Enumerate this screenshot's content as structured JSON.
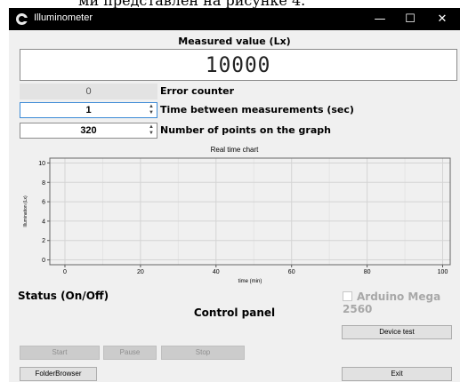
{
  "caption": "ми представлен на рисунке 4.",
  "window": {
    "title": "Illuminometer",
    "icon": "app-logo-icon",
    "controls": {
      "minimize": "—",
      "maximize": "☐",
      "close": "✕"
    }
  },
  "measured": {
    "label": "Measured value (Lx)",
    "value": "10000"
  },
  "error_counter": {
    "value": "0",
    "label": "Error counter"
  },
  "time_between": {
    "value": "1",
    "label": "Time between measurements (sec)"
  },
  "points": {
    "value": "320",
    "label": "Number of points on the graph"
  },
  "spin_arrow_up": "▲",
  "spin_arrow_down": "▼",
  "chart_data": {
    "type": "line",
    "title": "Real time chart",
    "xlabel": "time (min)",
    "ylabel": "Illumination (Lx)",
    "xlim": [
      -4,
      102
    ],
    "ylim": [
      -0.5,
      10.5
    ],
    "xticks": [
      0,
      20,
      40,
      60,
      80,
      100
    ],
    "yticks": [
      0,
      2,
      4,
      6,
      8,
      10
    ],
    "grid": true,
    "series": []
  },
  "status_label": "Status (On/Off)",
  "arduino": {
    "label": "Arduino Mega 2560",
    "checked": false
  },
  "control_panel": "Control panel",
  "buttons": {
    "device_test": "Device test",
    "start": "Start",
    "pause": "Pause",
    "stop": "Stop",
    "folder_browser": "FolderBrowser",
    "exit": "Exit"
  },
  "colors": {
    "titlebar": "#000000",
    "window": "#f0f0f0",
    "focus_border": "#3c8ad6"
  }
}
